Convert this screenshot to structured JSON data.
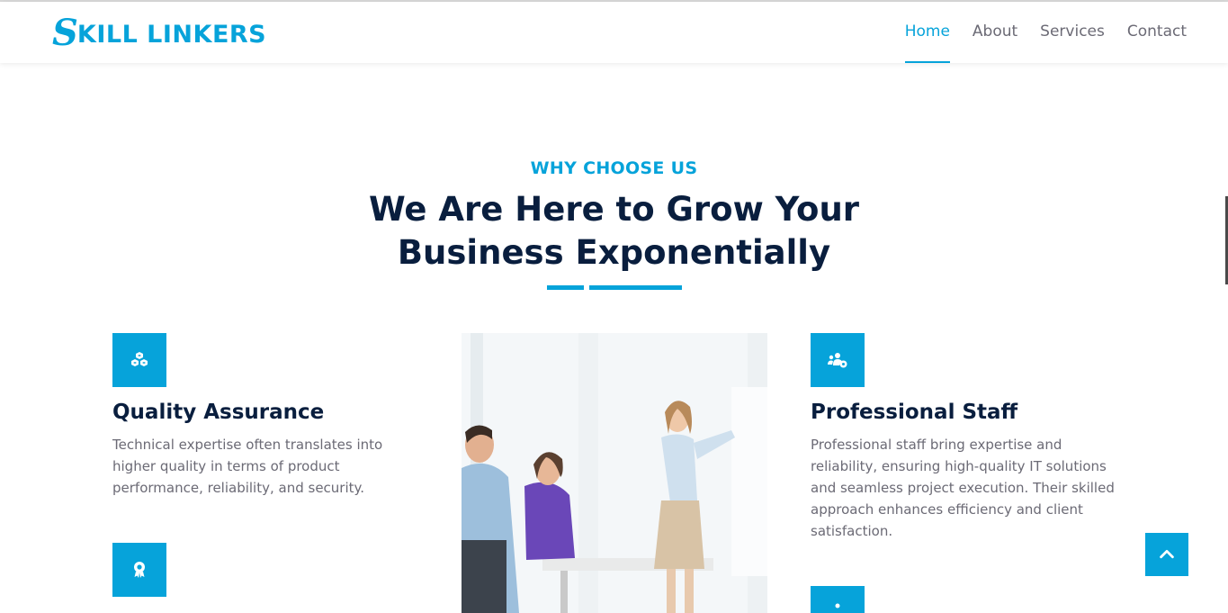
{
  "brand": {
    "logo_initial": "S",
    "logo_rest": "KILL LINKERS"
  },
  "nav": {
    "items": [
      {
        "label": "Home",
        "active": true
      },
      {
        "label": "About",
        "active": false
      },
      {
        "label": "Services",
        "active": false
      },
      {
        "label": "Contact",
        "active": false
      }
    ]
  },
  "section": {
    "eyebrow": "WHY CHOOSE US",
    "headline_line1": "We Are Here to Grow Your",
    "headline_line2": "Business Exponentially"
  },
  "features": {
    "left": [
      {
        "icon": "cubes-icon",
        "title": "Quality Assurance",
        "text_lines": [
          "Technical expertise often translates into",
          "higher quality in terms of product",
          "performance, reliability, and security."
        ]
      },
      {
        "icon": "award-icon"
      }
    ],
    "right": [
      {
        "icon": "users-gear-icon",
        "title": "Professional Staff",
        "text_lines": [
          "Professional staff bring expertise and",
          "reliability, ensuring high-quality IT solutions",
          "and seamless project execution. Their skilled",
          "approach enhances efficiency and client",
          "satisfaction."
        ]
      },
      {
        "icon": "phone-icon"
      }
    ]
  },
  "photo": {
    "subject": "business-meeting-image"
  },
  "back_to_top": {
    "icon": "chevron-up-icon"
  },
  "colors": {
    "accent": "#06a3da",
    "dark": "#091e3e",
    "body_text": "#6b6a75"
  }
}
